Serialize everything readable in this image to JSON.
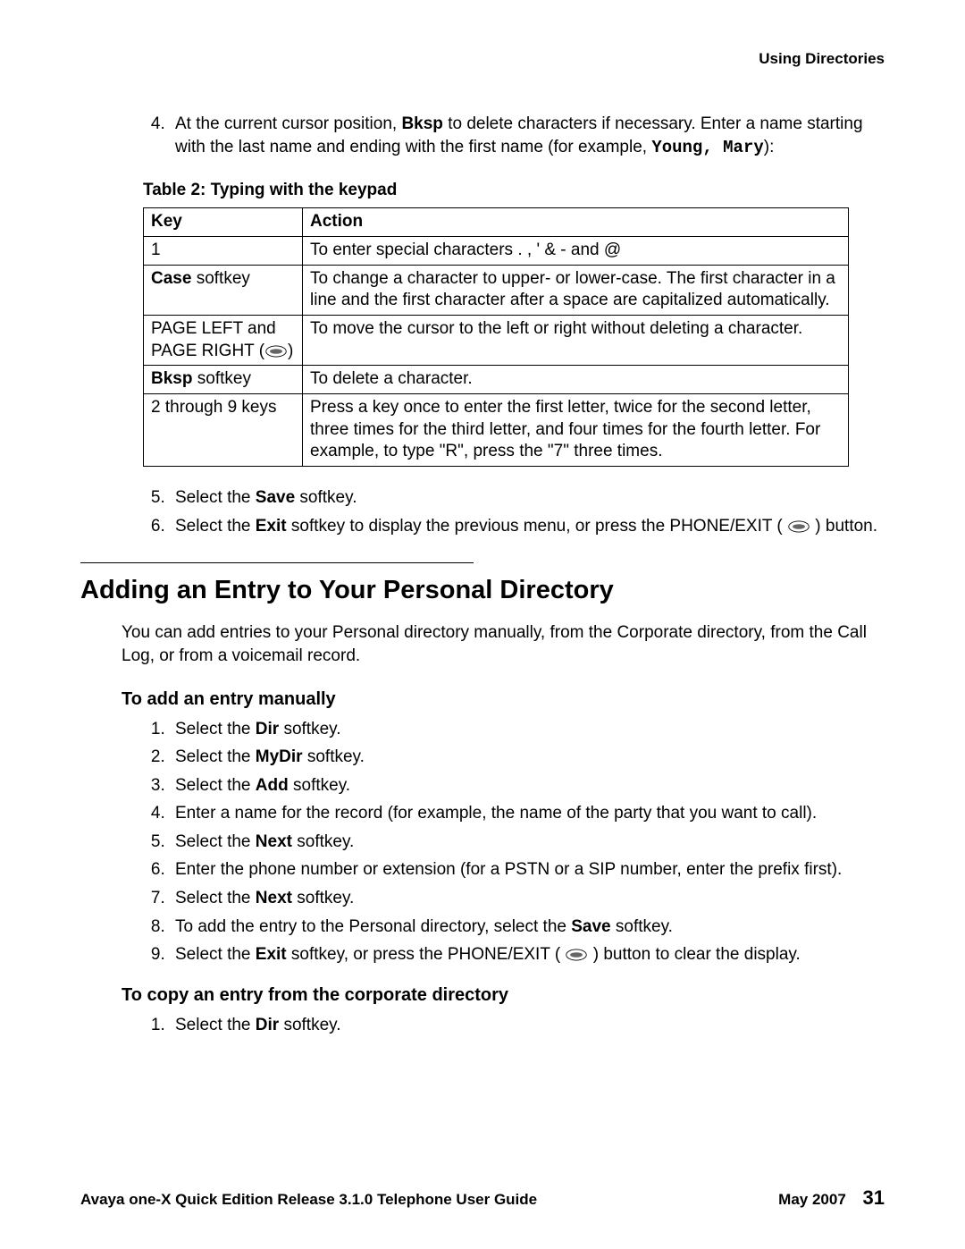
{
  "header": {
    "section": "Using Directories"
  },
  "intro_list": {
    "start": 4,
    "item_prefix": "At the current cursor position, ",
    "bksp": "Bksp",
    "item_mid": " to delete characters if necessary. Enter a name starting with the last name and ending with the first name (for example, ",
    "example": "Young, Mary",
    "item_suffix": "):"
  },
  "table": {
    "caption": "Table 2: Typing with the keypad",
    "headers": {
      "key": "Key",
      "action": "Action"
    },
    "rows": [
      {
        "key_plain": "1",
        "key_bold": "",
        "key_suffix": "",
        "action": "To enter special characters . , ' & - and @"
      },
      {
        "key_plain": "",
        "key_bold": "Case",
        "key_suffix": " softkey",
        "action": "To change a character to upper- or lower-case. The first character in a line and the first character after a space are capitalized automatically."
      },
      {
        "key_plain": "PAGE LEFT and PAGE RIGHT (",
        "key_bold": "",
        "key_suffix": ")",
        "has_icon": true,
        "action": "To move the cursor to the left or right without deleting a character."
      },
      {
        "key_plain": "",
        "key_bold": "Bksp",
        "key_suffix": " softkey",
        "action": "To delete a character."
      },
      {
        "key_plain": "2 through 9 keys",
        "key_bold": "",
        "key_suffix": "",
        "action": "Press a key once to enter the first letter, twice for the second letter, three times for the third letter, and four times for the fourth letter. For example, to type \"R\", press the \"7\" three times."
      }
    ]
  },
  "after_table": {
    "start": 5,
    "items": [
      {
        "pre": "Select the ",
        "bold": "Save",
        "post": " softkey."
      },
      {
        "pre": "Select the ",
        "bold": "Exit",
        "post": " softkey to display the previous menu, or press the PHONE/EXIT ( ",
        "icon": true,
        "post2": " ) button."
      }
    ]
  },
  "section2": {
    "title": "Adding an Entry to Your Personal Directory",
    "intro": "You can add entries to your Personal directory manually, from the Corporate directory, from the Call Log, or from a voicemail record.",
    "sub1": {
      "title": "To add an entry manually",
      "items": [
        {
          "pre": "Select the ",
          "bold": "Dir",
          "post": " softkey."
        },
        {
          "pre": "Select the ",
          "bold": "MyDir",
          "post": " softkey."
        },
        {
          "pre": "Select the ",
          "bold": "Add",
          "post": " softkey."
        },
        {
          "pre": "Enter a name for the record (for example, the name of the party that you want to call).",
          "bold": "",
          "post": ""
        },
        {
          "pre": "Select the ",
          "bold": "Next",
          "post": " softkey."
        },
        {
          "pre": "Enter the phone number or extension (for a PSTN or a SIP number, enter the prefix first).",
          "bold": "",
          "post": ""
        },
        {
          "pre": "Select the ",
          "bold": "Next",
          "post": " softkey."
        },
        {
          "pre": "To add the entry to the Personal directory, select the ",
          "bold": "Save",
          "post": " softkey."
        },
        {
          "pre": "Select the ",
          "bold": "Exit",
          "post": " softkey, or press the PHONE/EXIT ( ",
          "icon": true,
          "post2": " ) button to clear the display."
        }
      ]
    },
    "sub2": {
      "title": "To copy an entry from the corporate directory",
      "items": [
        {
          "pre": "Select the ",
          "bold": "Dir",
          "post": " softkey."
        }
      ]
    }
  },
  "footer": {
    "left": "Avaya one-X Quick Edition Release 3.1.0 Telephone User Guide",
    "right_date": "May 2007",
    "page": "31"
  }
}
